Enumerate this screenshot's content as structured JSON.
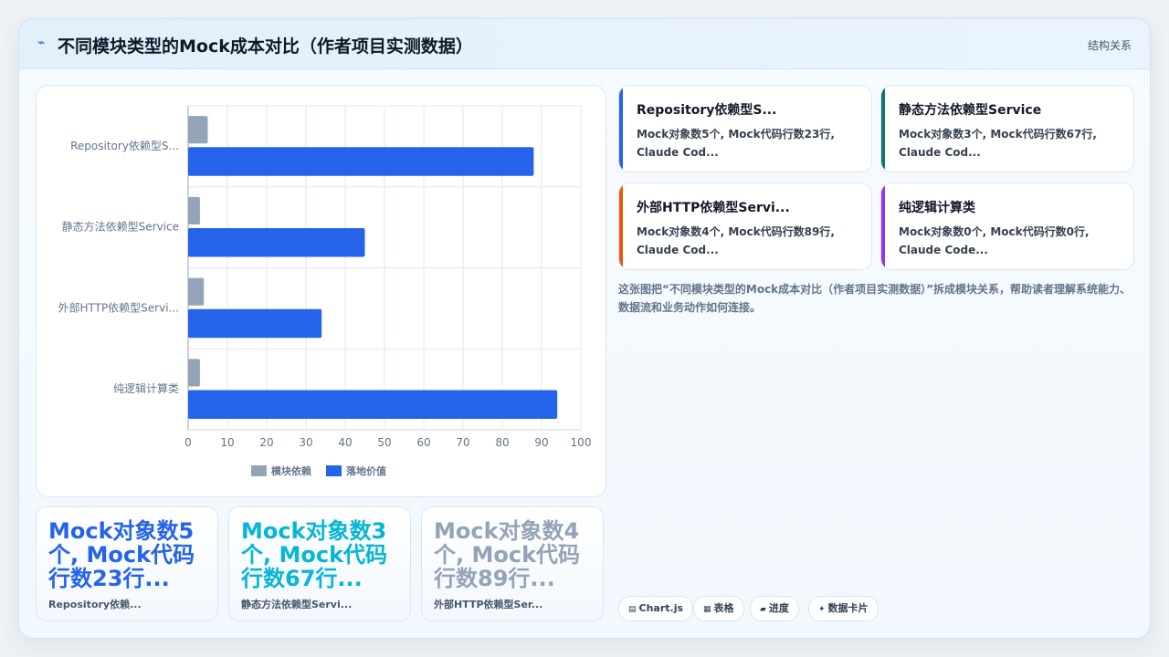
{
  "header": {
    "logo_icon": "spark-icon",
    "title": "不同模块类型的Mock成本对比（作者项目实测数据）",
    "right_label": "结构关系"
  },
  "chart_data": {
    "type": "bar",
    "orientation": "horizontal",
    "categories": [
      "Repository依赖型S...",
      "静态方法依赖型Service",
      "外部HTTP依赖型Servi...",
      "纯逻辑计算类"
    ],
    "series": [
      {
        "name": "模块依赖",
        "color": "#94a3b8",
        "values": [
          5,
          3,
          4,
          3
        ]
      },
      {
        "name": "落地价值",
        "color": "#2563eb",
        "values": [
          88,
          45,
          34,
          94
        ]
      }
    ],
    "xlim": [
      0,
      100
    ],
    "xticks": [
      0,
      10,
      20,
      30,
      40,
      50,
      60,
      70,
      80,
      90,
      100
    ],
    "grid": true,
    "legend_position": "bottom"
  },
  "stats": [
    {
      "big": "Mock对象数5个, Mock代码行数23行...",
      "small": "Repository依赖...",
      "color": "#2563eb"
    },
    {
      "big": "Mock对象数3个, Mock代码行数67行...",
      "small": "静态方法依赖型Servi...",
      "color": "#06b6d4"
    },
    {
      "big": "Mock对象数4个, Mock代码行数89行...",
      "small": "外部HTTP依赖型Ser...",
      "color": "#94a3b8"
    }
  ],
  "cards": [
    {
      "title": "Repository依赖型S...",
      "body": "Mock对象数5个, Mock代码行数23行, Claude Cod...",
      "color": "#2563eb"
    },
    {
      "title": "静态方法依赖型Service",
      "body": "Mock对象数3个, Mock代码行数67行, Claude Cod...",
      "color": "#0f766e"
    },
    {
      "title": "外部HTTP依赖型Servi...",
      "body": "Mock对象数4个, Mock代码行数89行, Claude Cod...",
      "color": "#ea580c"
    },
    {
      "title": "纯逻辑计算类",
      "body": "Mock对象数0个, Mock代码行数0行, Claude Code...",
      "color": "#9333ea"
    }
  ],
  "description": "这张图把“不同模块类型的Mock成本对比（作者项目实测数据）”拆成模块关系，帮助读者理解系统能力、数据流和业务动作如何连接。",
  "tags": [
    {
      "icon": "▤",
      "label": "Chart.js"
    },
    {
      "icon": "▦",
      "label": "表格"
    },
    {
      "icon": "▰",
      "label": "进度"
    },
    {
      "icon": "✦",
      "label": "数据卡片"
    }
  ]
}
